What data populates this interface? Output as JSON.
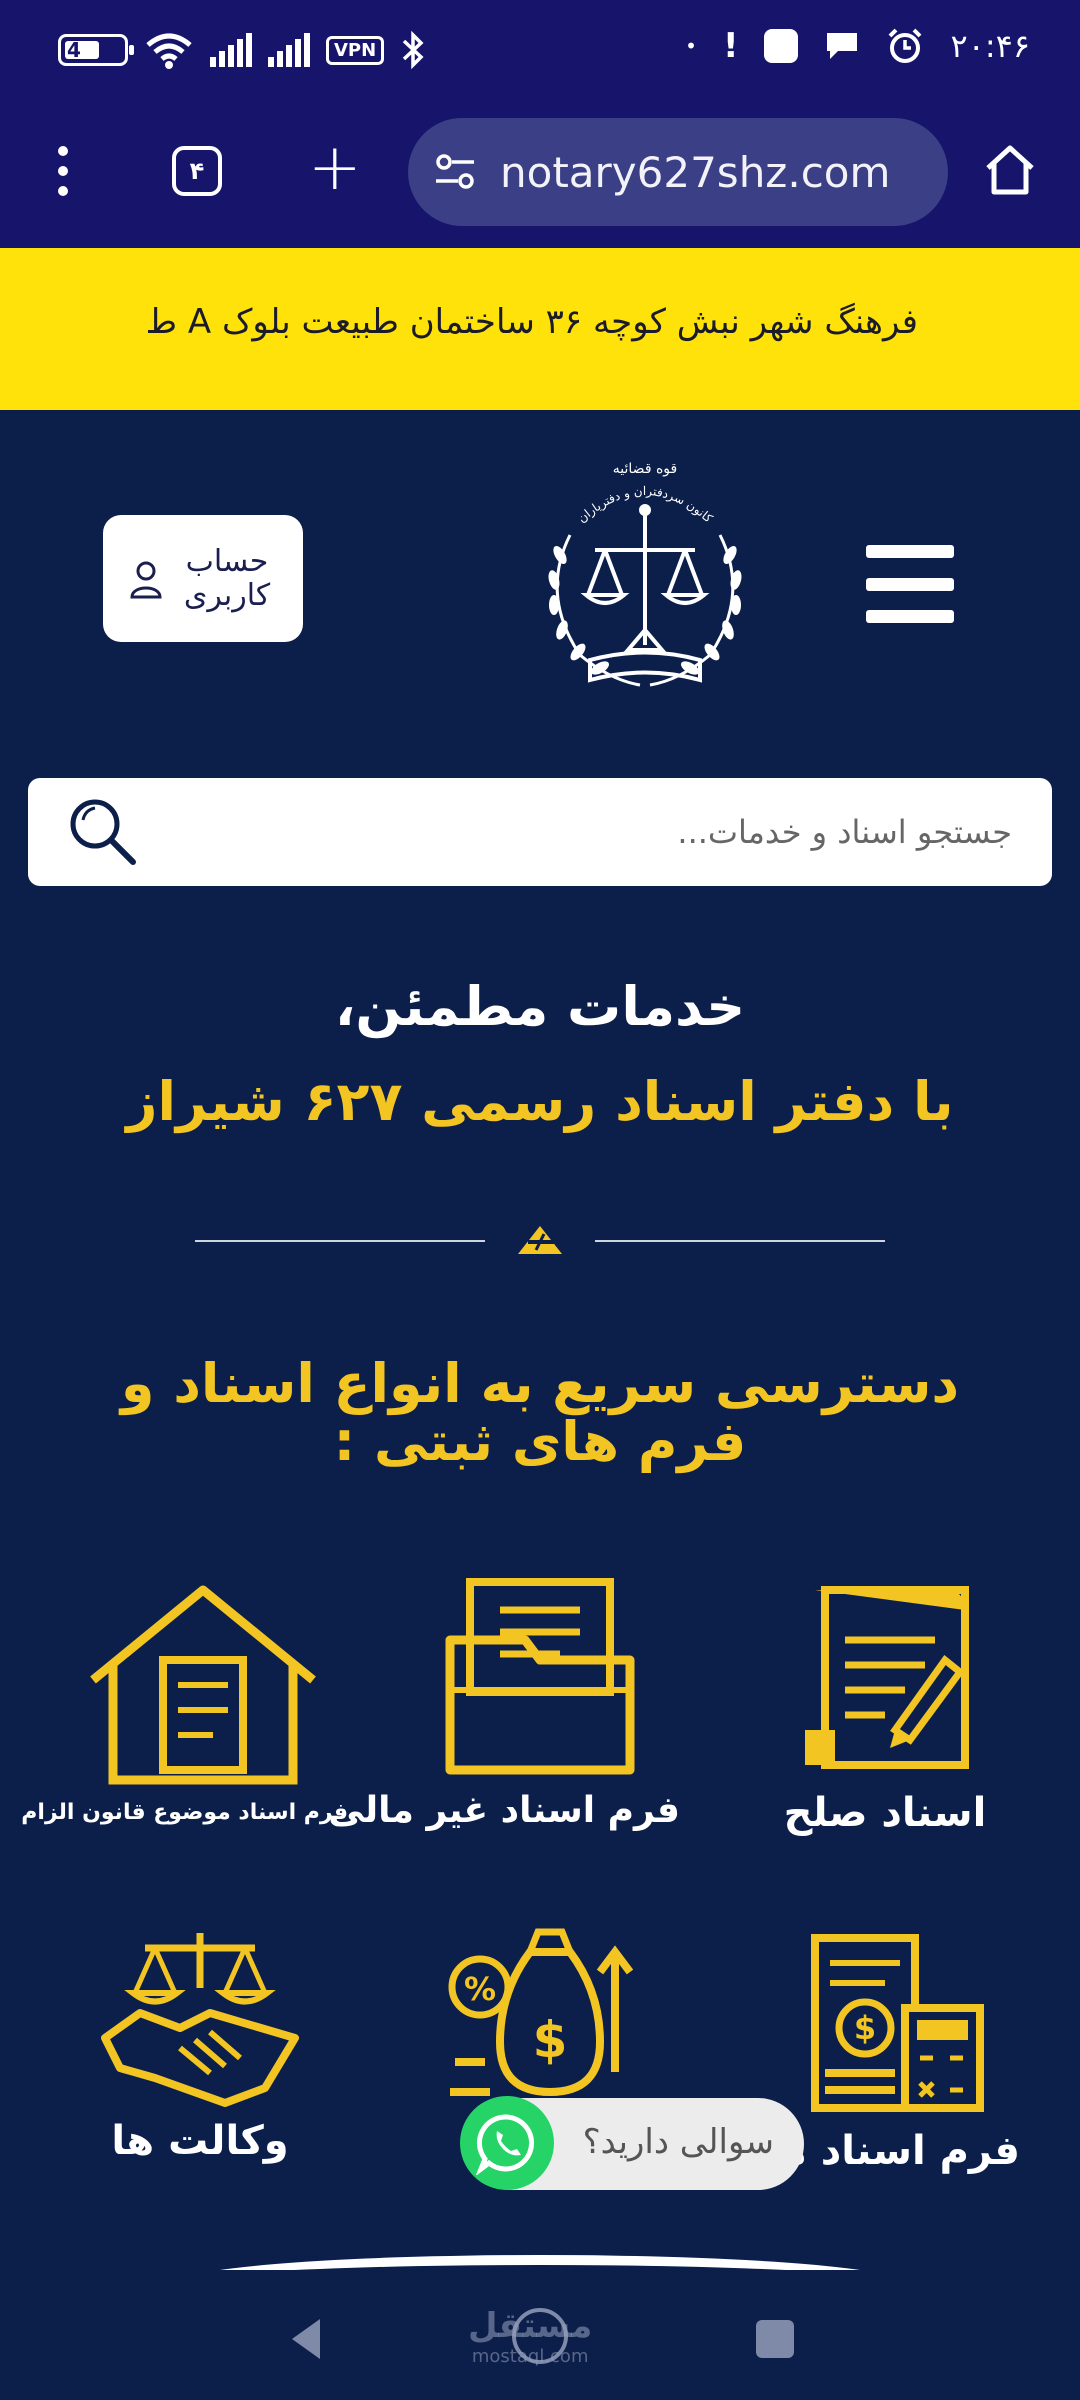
{
  "status_bar": {
    "battery": "4",
    "vpn": "VPN",
    "time": "۲۰:۴۶"
  },
  "browser": {
    "tab_count": "۴",
    "url": "notary627shz.com"
  },
  "banner": {
    "address": "فرهنگ شهر نبش کوچه ۳۶ ساختمان طبیعت بلوک A ط"
  },
  "header": {
    "account_label": "حساب کاربری",
    "logo_text_top": "قوه قضائیه",
    "logo_text_arc": "کانون سردفتران و دفتریاران"
  },
  "search": {
    "placeholder": "جستجو اسناد و خدمات..."
  },
  "hero": {
    "line1": "خدمات مطمئن،",
    "line2": "با دفتر اسناد رسمی ۶۲۷ شیراز"
  },
  "section": {
    "title": "دسترسی سریع به انواع اسناد و فرم های ثبتی :"
  },
  "services": [
    {
      "label": "اسناد صلح",
      "icon": "document-sign-icon"
    },
    {
      "label": "فرم اسناد غیر مالی",
      "icon": "folder-documents-icon"
    },
    {
      "label": "فرم اسناد موضوع قانون الزام",
      "icon": "house-document-icon"
    },
    {
      "label": "فرم اسناد مالی",
      "icon": "invoice-calculator-icon"
    },
    {
      "label": "",
      "icon": "money-growth-icon"
    },
    {
      "label": "وکالت ها",
      "icon": "scales-handshake-icon"
    }
  ],
  "whatsapp": {
    "label": "سوالی دارید؟"
  },
  "watermark": {
    "text": "مستقل",
    "sub": "mostaql.com"
  },
  "colors": {
    "page_bg": "#0c1f4a",
    "browser_bg": "#16156b",
    "banner": "#ffe20a",
    "accent": "#f3c522",
    "whatsapp": "#25d366"
  }
}
